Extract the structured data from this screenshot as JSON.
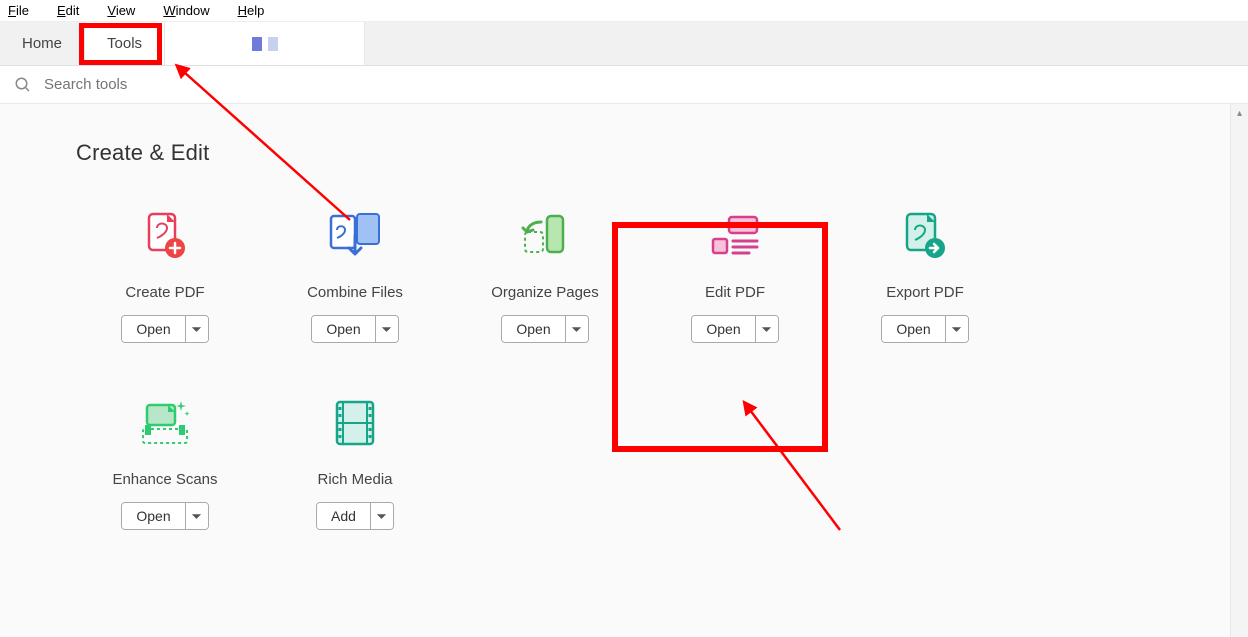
{
  "menubar": {
    "file": "File",
    "edit": "Edit",
    "view": "View",
    "window": "Window",
    "help": "Help"
  },
  "tabs": {
    "home": "Home",
    "tools": "Tools"
  },
  "search": {
    "placeholder": "Search tools"
  },
  "section": {
    "title": "Create & Edit"
  },
  "tools": {
    "create_pdf": {
      "label": "Create PDF",
      "button": "Open"
    },
    "combine_files": {
      "label": "Combine Files",
      "button": "Open"
    },
    "organize_pages": {
      "label": "Organize Pages",
      "button": "Open"
    },
    "edit_pdf": {
      "label": "Edit PDF",
      "button": "Open"
    },
    "export_pdf": {
      "label": "Export PDF",
      "button": "Open"
    },
    "enhance_scans": {
      "label": "Enhance Scans",
      "button": "Open"
    },
    "rich_media": {
      "label": "Rich Media",
      "button": "Add"
    }
  }
}
